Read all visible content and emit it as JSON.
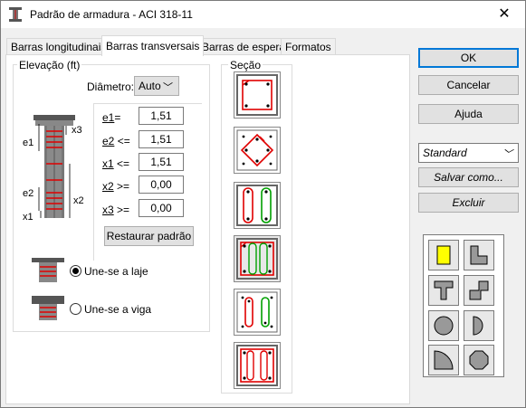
{
  "window": {
    "title": "Padrão de armadura - ACI 318-11",
    "close_label": "✕"
  },
  "tabs": [
    "Barras longitudinais",
    "Barras transversais",
    "Barras de espera",
    "Formatos"
  ],
  "elevation": {
    "group_label": "Elevação (ft)",
    "diameter_label": "Diâmetro:",
    "diameter_value": "Auto",
    "params": [
      {
        "key": "e1",
        "op": "=",
        "value": "1,51"
      },
      {
        "key": "e2",
        "op": "<=",
        "value": "1,51"
      },
      {
        "key": "x1",
        "op": "<=",
        "value": "1,51"
      },
      {
        "key": "x2",
        "op": ">=",
        "value": "0,00"
      },
      {
        "key": "x3",
        "op": ">=",
        "value": "0,00"
      }
    ],
    "restore_label": "Restaurar padrão",
    "diagram_labels": {
      "x3": "x3",
      "e1": "e1",
      "e2": "e2",
      "x2": "x2",
      "x1": "x1"
    },
    "options": [
      {
        "label": "Une-se a laje",
        "selected": true
      },
      {
        "label": "Une-se a viga",
        "selected": false
      }
    ]
  },
  "section": {
    "group_label": "Seção",
    "tiles": 6,
    "selected_tile": 3
  },
  "actions": {
    "ok": "OK",
    "cancel": "Cancelar",
    "help": "Ajuda"
  },
  "presets": {
    "value": "Standard",
    "save_as": "Salvar como...",
    "delete": "Excluir"
  },
  "shapes": [
    "rectangle",
    "l-shape",
    "t-shape",
    "z-shape",
    "circle",
    "half-circle",
    "quarter-circle",
    "octagon"
  ],
  "colors": {
    "accent": "#0078d7",
    "rebar_red": "#e00000",
    "rebar_green": "#00a000",
    "shape_yellow": "#ffff00"
  }
}
